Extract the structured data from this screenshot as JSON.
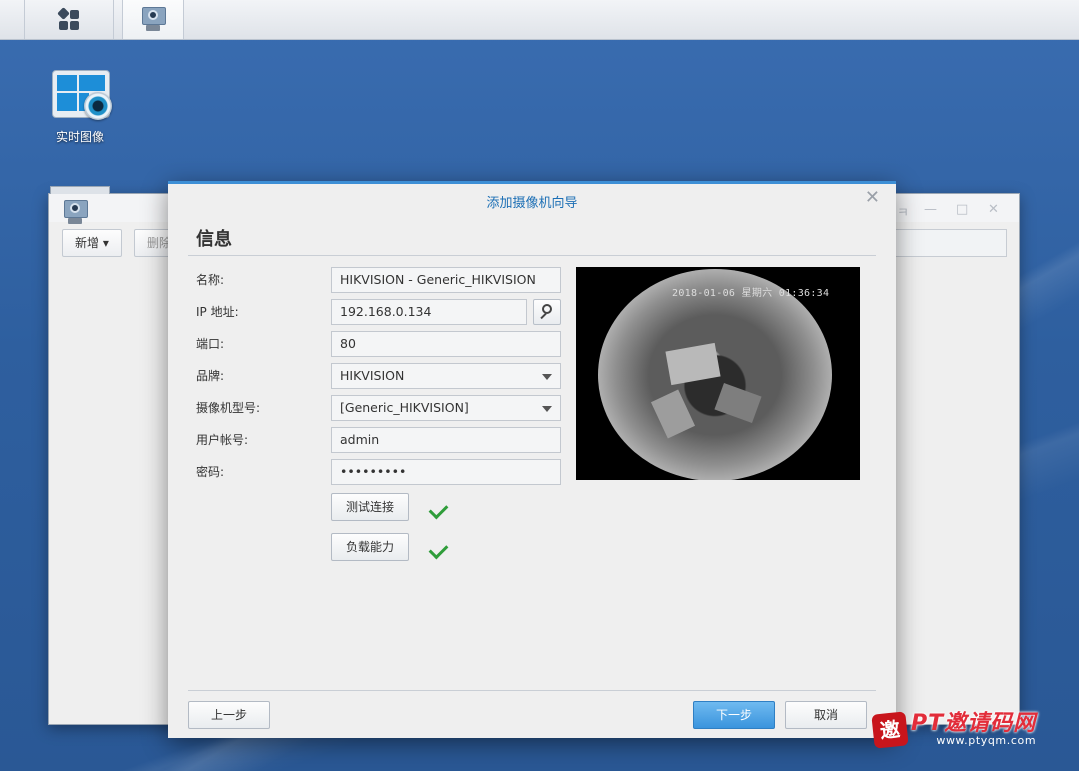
{
  "desktop": {
    "icon_label": "实时图像"
  },
  "background_window": {
    "add_button": "新增 ▾",
    "delete_button": "删除",
    "controls": [
      "ㅋ",
      "—",
      "□",
      "✕"
    ]
  },
  "dialog": {
    "title": "添加摄像机向导",
    "section_title": "信息",
    "fields": {
      "name_label": "名称:",
      "name_value": "HIKVISION - Generic_HIKVISION",
      "ip_label": "IP 地址:",
      "ip_value": "192.168.0.134",
      "port_label": "端口:",
      "port_value": "80",
      "brand_label": "品牌:",
      "brand_value": "HIKVISION",
      "model_label": "摄像机型号:",
      "model_value": "[Generic_HIKVISION]",
      "user_label": "用户帐号:",
      "user_value": "admin",
      "password_label": "密码:",
      "password_value": "•••••••••"
    },
    "test_button": "测试连接",
    "capability_button": "负载能力",
    "preview_osd": "2018-01-06 星期六 01:36:34",
    "back_button": "上一步",
    "next_button": "下一步",
    "cancel_button": "取消"
  },
  "watermark": {
    "seal": "邀",
    "main": "PT邀请码网",
    "url": "www.ptyqm.com"
  },
  "colors": {
    "accent": "#3a94dd",
    "title_blue": "#1c6fb5",
    "check_green": "#2f9d3a"
  }
}
